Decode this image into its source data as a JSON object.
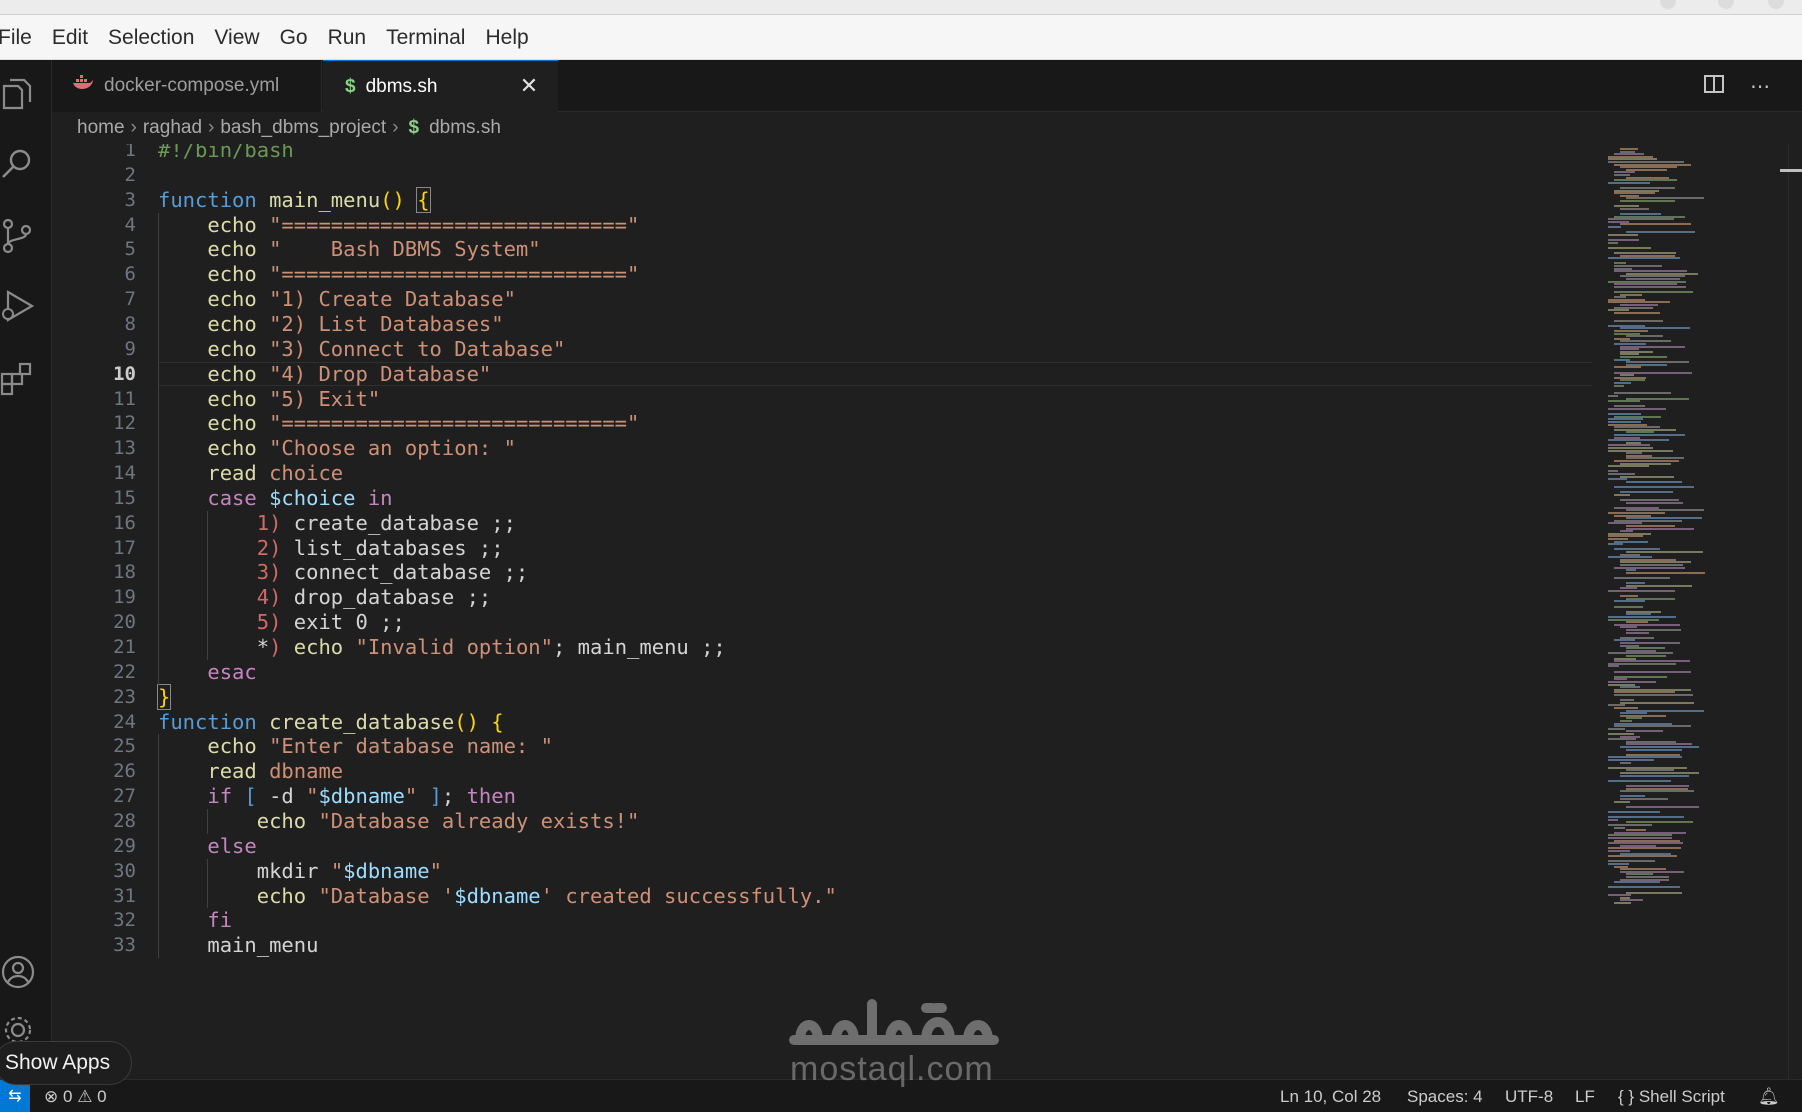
{
  "menu": [
    "File",
    "Edit",
    "Selection",
    "View",
    "Go",
    "Run",
    "Terminal",
    "Help"
  ],
  "tabs": [
    {
      "label": "docker-compose.yml",
      "icon": "docker-whale-icon",
      "active": false
    },
    {
      "label": "dbms.sh",
      "icon": "dollar-shell-icon",
      "active": true
    }
  ],
  "breadcrumb": [
    "home",
    "raghad",
    "bash_dbms_project",
    "dbms.sh"
  ],
  "colors": {
    "accent": "#0078d4",
    "shell_icon": "#89d185",
    "docker_icon": "#e06c75"
  },
  "editor": {
    "current_line": 10,
    "lines": [
      [
        [
          "#!/bin/bash",
          "cm"
        ]
      ],
      [],
      [
        [
          "function",
          "kw"
        ],
        [
          " ",
          ""
        ],
        [
          "main_menu",
          "fn"
        ],
        [
          "()",
          "br"
        ],
        [
          " ",
          ""
        ],
        [
          "{",
          "bm"
        ]
      ],
      [
        [
          "    ",
          ""
        ],
        [
          "echo",
          "bi"
        ],
        [
          " ",
          ""
        ],
        [
          "\"============================\"",
          "str"
        ]
      ],
      [
        [
          "    ",
          ""
        ],
        [
          "echo",
          "bi"
        ],
        [
          " ",
          ""
        ],
        [
          "\"    Bash DBMS System\"",
          "str"
        ]
      ],
      [
        [
          "    ",
          ""
        ],
        [
          "echo",
          "bi"
        ],
        [
          " ",
          ""
        ],
        [
          "\"============================\"",
          "str"
        ]
      ],
      [
        [
          "    ",
          ""
        ],
        [
          "echo",
          "bi"
        ],
        [
          " ",
          ""
        ],
        [
          "\"1) Create Database\"",
          "str"
        ]
      ],
      [
        [
          "    ",
          ""
        ],
        [
          "echo",
          "bi"
        ],
        [
          " ",
          ""
        ],
        [
          "\"2) List Databases\"",
          "str"
        ]
      ],
      [
        [
          "    ",
          ""
        ],
        [
          "echo",
          "bi"
        ],
        [
          " ",
          ""
        ],
        [
          "\"3) Connect to Database\"",
          "str"
        ]
      ],
      [
        [
          "    ",
          ""
        ],
        [
          "echo",
          "bi"
        ],
        [
          " ",
          ""
        ],
        [
          "\"4) Drop Database\"",
          "str"
        ]
      ],
      [
        [
          "    ",
          ""
        ],
        [
          "echo",
          "bi"
        ],
        [
          " ",
          ""
        ],
        [
          "\"5) Exit\"",
          "str"
        ]
      ],
      [
        [
          "    ",
          ""
        ],
        [
          "echo",
          "bi"
        ],
        [
          " ",
          ""
        ],
        [
          "\"============================\"",
          "str"
        ]
      ],
      [
        [
          "    ",
          ""
        ],
        [
          "echo",
          "bi"
        ],
        [
          " ",
          ""
        ],
        [
          "\"Choose an option: \"",
          "str"
        ]
      ],
      [
        [
          "    ",
          ""
        ],
        [
          "read",
          "bi"
        ],
        [
          " ",
          ""
        ],
        [
          "choice",
          "str"
        ]
      ],
      [
        [
          "    ",
          ""
        ],
        [
          "case",
          "ctl"
        ],
        [
          " ",
          ""
        ],
        [
          "$choice",
          "var"
        ],
        [
          " ",
          ""
        ],
        [
          "in",
          "ctl"
        ]
      ],
      [
        [
          "        ",
          ""
        ],
        [
          "1)",
          "pat"
        ],
        [
          " create_database ;;",
          ""
        ]
      ],
      [
        [
          "        ",
          ""
        ],
        [
          "2)",
          "pat"
        ],
        [
          " list_databases ;;",
          ""
        ]
      ],
      [
        [
          "        ",
          ""
        ],
        [
          "3)",
          "pat"
        ],
        [
          " connect_database ;;",
          ""
        ]
      ],
      [
        [
          "        ",
          ""
        ],
        [
          "4)",
          "pat"
        ],
        [
          " drop_database ;;",
          ""
        ]
      ],
      [
        [
          "        ",
          ""
        ],
        [
          "5)",
          "pat"
        ],
        [
          " exit 0 ;;",
          ""
        ]
      ],
      [
        [
          "        ",
          ""
        ],
        [
          "*",
          ""
        ],
        [
          ")",
          "pat"
        ],
        [
          " ",
          ""
        ],
        [
          "echo",
          "bi"
        ],
        [
          " ",
          ""
        ],
        [
          "\"Invalid option\"",
          "str"
        ],
        [
          "; main_menu ;;",
          ""
        ]
      ],
      [
        [
          "    ",
          ""
        ],
        [
          "esac",
          "ctl"
        ]
      ],
      [
        [
          "}",
          "bm"
        ]
      ],
      [
        [
          "function",
          "kw"
        ],
        [
          " ",
          ""
        ],
        [
          "create_database",
          "fn"
        ],
        [
          "()",
          "br"
        ],
        [
          " ",
          ""
        ],
        [
          "{",
          "br"
        ]
      ],
      [
        [
          "    ",
          ""
        ],
        [
          "echo",
          "bi"
        ],
        [
          " ",
          ""
        ],
        [
          "\"Enter database name: \"",
          "str"
        ]
      ],
      [
        [
          "    ",
          ""
        ],
        [
          "read",
          "bi"
        ],
        [
          " ",
          ""
        ],
        [
          "dbname",
          "str"
        ]
      ],
      [
        [
          "    ",
          ""
        ],
        [
          "if",
          "ctl"
        ],
        [
          " ",
          ""
        ],
        [
          "[",
          "kw"
        ],
        [
          " -d ",
          ""
        ],
        [
          "\"",
          "str"
        ],
        [
          "$dbname",
          "var"
        ],
        [
          "\"",
          "str"
        ],
        [
          " ",
          ""
        ],
        [
          "]",
          "kw"
        ],
        [
          "; ",
          ""
        ],
        [
          "then",
          "ctl"
        ]
      ],
      [
        [
          "        ",
          ""
        ],
        [
          "echo",
          "bi"
        ],
        [
          " ",
          ""
        ],
        [
          "\"Database already exists!\"",
          "str"
        ]
      ],
      [
        [
          "    ",
          ""
        ],
        [
          "else",
          "ctl"
        ]
      ],
      [
        [
          "        ",
          ""
        ],
        [
          "mkdir",
          ""
        ],
        [
          " ",
          ""
        ],
        [
          "\"",
          "str"
        ],
        [
          "$dbname",
          "var"
        ],
        [
          "\"",
          "str"
        ]
      ],
      [
        [
          "        ",
          ""
        ],
        [
          "echo",
          "bi"
        ],
        [
          " ",
          ""
        ],
        [
          "\"Database '",
          "str"
        ],
        [
          "$dbname",
          "var"
        ],
        [
          "' created successfully.\"",
          "str"
        ]
      ],
      [
        [
          "    ",
          ""
        ],
        [
          "fi",
          "ctl"
        ]
      ],
      [
        [
          "    ",
          ""
        ],
        [
          "main_menu",
          ""
        ]
      ]
    ]
  },
  "status": {
    "errors": "0",
    "warnings": "0",
    "position": "Ln 10, Col 28",
    "spaces": "Spaces: 4",
    "encoding": "UTF-8",
    "eol": "LF",
    "language": "Shell Script"
  },
  "show_apps": "Show Apps",
  "watermark": {
    "arabic": "مستقل",
    "latin": "mostaql.com"
  }
}
